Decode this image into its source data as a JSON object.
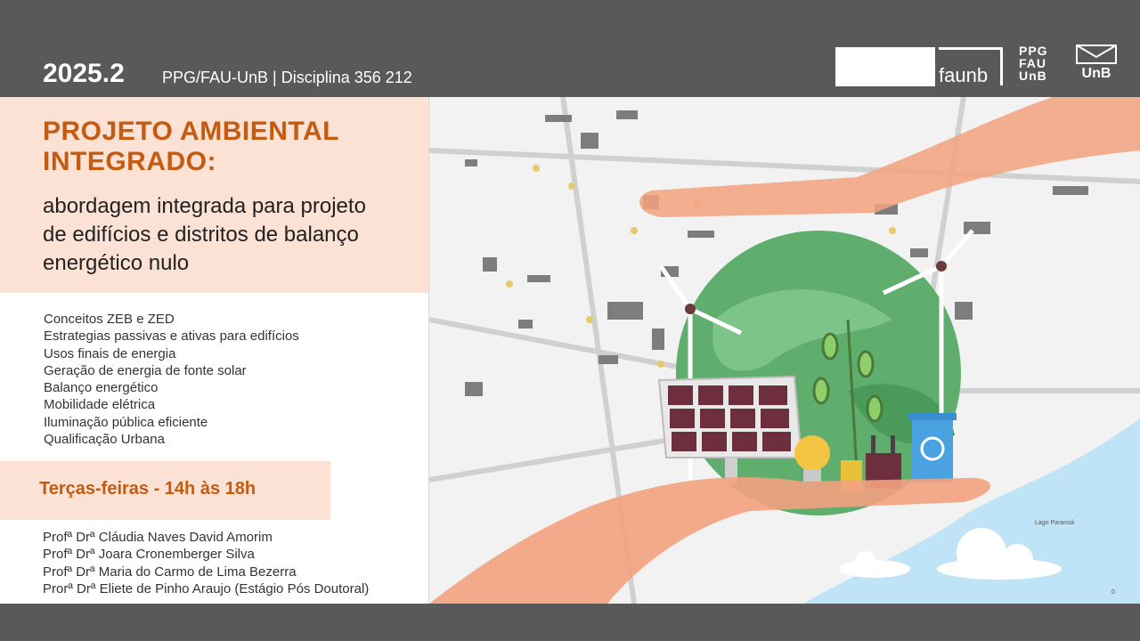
{
  "header": {
    "year": "2025.2",
    "course": "PPG/FAU-UnB | Disciplina 356 212",
    "logos": {
      "faunb": "faunb",
      "ppg": [
        "PPG",
        "FAU",
        "UnB"
      ],
      "unb": "UnB"
    }
  },
  "title": {
    "line1": "PROJETO AMBIENTAL",
    "line2": "INTEGRADO:"
  },
  "subtitle": {
    "line1": "abordagem integrada para projeto",
    "line2": "de edifícios e distritos de balanço",
    "line3": "energético nulo"
  },
  "topics": [
    "Conceitos ZEB e ZED",
    "Estrategias passivas e ativas para edifícios",
    "Usos finais de energia",
    "Geração de energia de fonte solar",
    "Balanço energético",
    "Mobilidade elétrica",
    "Iluminação pública eficiente",
    "Qualificação Urbana"
  ],
  "schedule": "Terças-feiras - 14h às 18h",
  "professors": [
    "Profª Drª Cláudia Naves David Amorim",
    "Profª Drª Joara Cronemberger Silva",
    "Profª Drª Maria do Carmo de Lima Bezerra",
    "Prorª Drª Eliete de Pinho Araujo (Estágio Pós Doutoral)"
  ],
  "map": {
    "lake_label": "Lago Paranoá",
    "scale_label": "0"
  },
  "colors": {
    "accent": "#c55a11",
    "panel": "#fbe2d5",
    "bar": "#595959",
    "globe": "#5fae6e",
    "hand": "#f3a27f",
    "water": "#bfe3f7"
  }
}
